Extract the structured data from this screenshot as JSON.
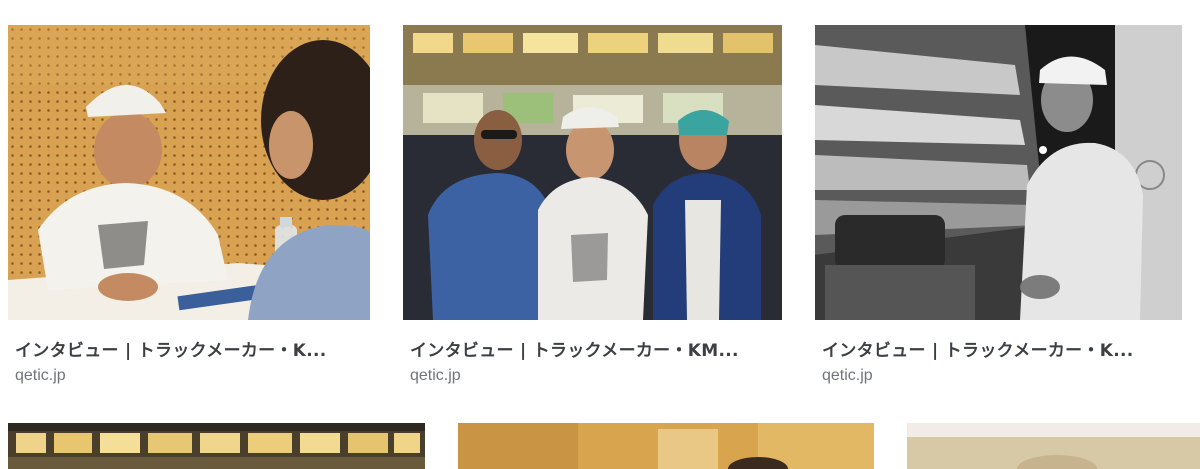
{
  "results": [
    {
      "title": "インタビュー | トラックメーカー・K...",
      "source": "qetic.jp"
    },
    {
      "title": "インタビュー | トラックメーカー・KM...",
      "source": "qetic.jp"
    },
    {
      "title": "インタビュー | トラックメーカー・K...",
      "source": "qetic.jp"
    }
  ],
  "colors": {
    "title": "#3c4043",
    "source": "#70757a"
  }
}
